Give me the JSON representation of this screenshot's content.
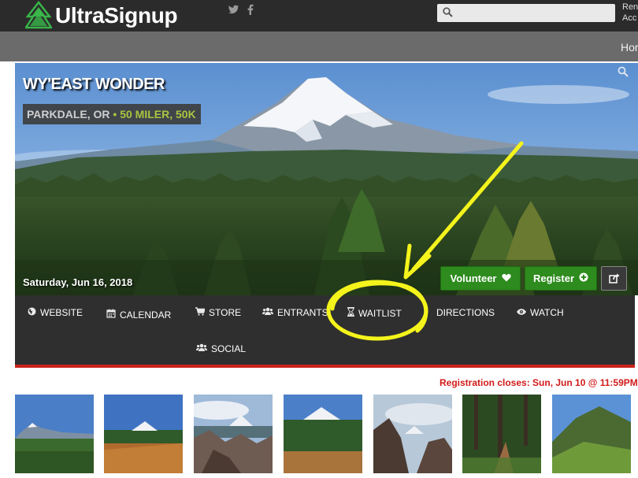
{
  "header": {
    "logo_text": "UltraSignup",
    "search_placeholder": "",
    "account_line1": "Ren",
    "account_line2": "Acc"
  },
  "nav": {
    "home_label": "Hor"
  },
  "race": {
    "title": "WY'EAST WONDER",
    "location": "PARKDALE, OR",
    "separator": "•",
    "distances": "50 MILER, 50K",
    "date": "Saturday, Jun 16, 2018"
  },
  "buttons": {
    "volunteer_label": "Volunteer",
    "register_label": "Register"
  },
  "menu": {
    "website": "WEBSITE",
    "calendar": "CALENDAR",
    "store": "STORE",
    "entrants": "ENTRANTS",
    "waitlist": "WAITLIST",
    "directions": "DIRECTIONS",
    "watch": "WATCH",
    "social": "SOCIAL"
  },
  "registration_note": "Registration closes: Sun, Jun 10 @ 11:59PM",
  "colors": {
    "accent_green": "#2e8b1e",
    "distance_green": "#a9c540",
    "menu_red": "#c9231d",
    "annotation_yellow": "#f4f41c"
  },
  "icons": {
    "twitter": "twitter-icon",
    "facebook": "facebook-icon",
    "search": "search-icon",
    "heart": "heart-icon",
    "plus": "plus-circle-icon",
    "share": "share-icon",
    "globe": "globe-icon",
    "calendar": "calendar-icon",
    "cart": "cart-icon",
    "group": "group-icon",
    "hourglass": "hourglass-icon",
    "signpost": "signpost-icon",
    "eye": "eye-icon"
  }
}
